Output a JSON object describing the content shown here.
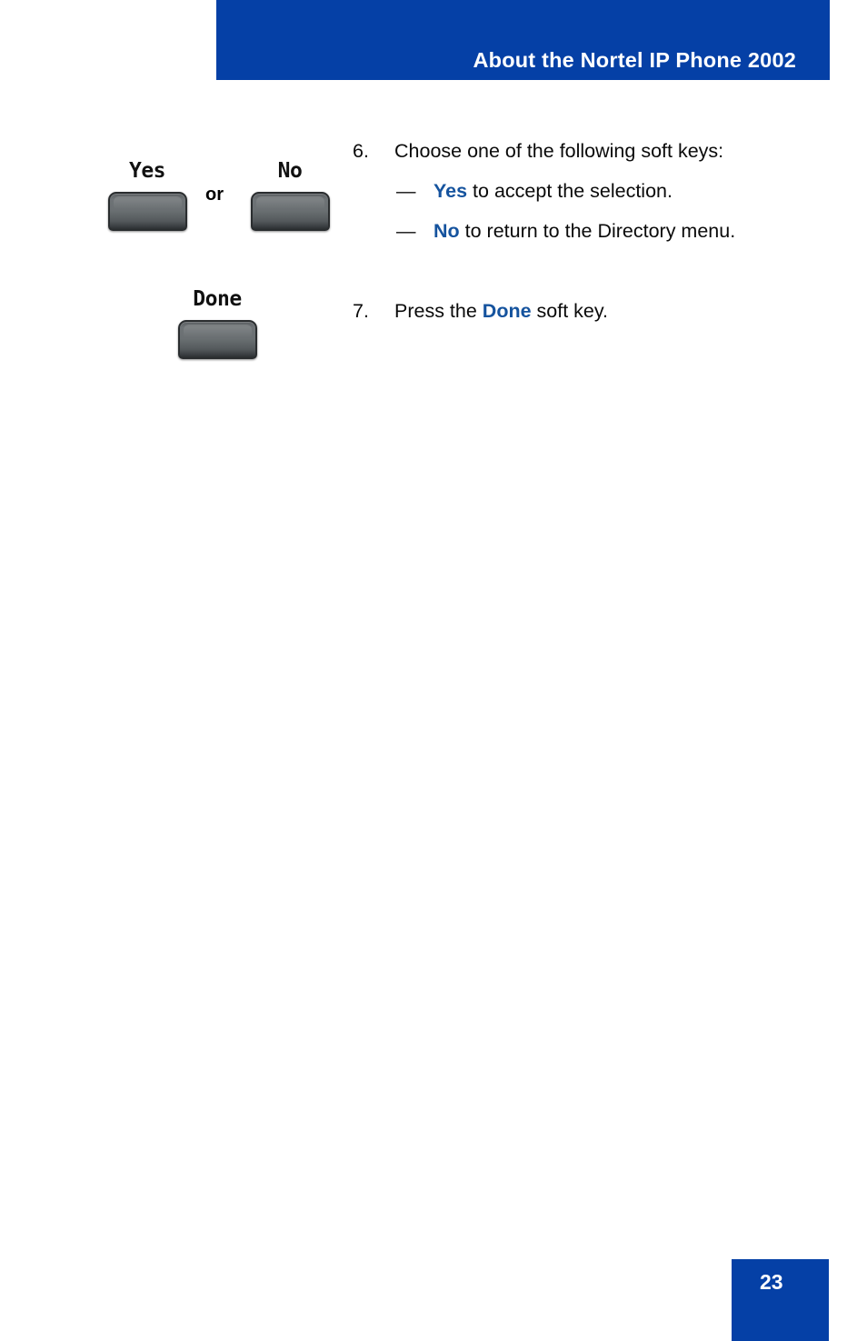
{
  "document": {
    "header": {
      "title": "About the Nortel IP Phone 2002",
      "band_color": "#0540a6"
    },
    "page_number": "23",
    "accent_color": "#15539e"
  },
  "figures": {
    "softkeys_yes_no": {
      "conjunction": "or",
      "keys": [
        {
          "label": "Yes",
          "icon": "softkey-button"
        },
        {
          "label": "No",
          "icon": "softkey-button"
        }
      ]
    },
    "softkey_done": {
      "keys": [
        {
          "label": "Done",
          "icon": "softkey-button"
        }
      ]
    }
  },
  "steps": [
    {
      "number": "6.",
      "text": "Choose one of the following soft keys:",
      "subitems": [
        {
          "dash": "—",
          "key": "Yes",
          "rest": " to accept the selection."
        },
        {
          "dash": "—",
          "key": "No",
          "rest": " to return to the Directory menu."
        }
      ]
    },
    {
      "number": "7.",
      "prefix": "Press the ",
      "key": "Done",
      "suffix": " soft key."
    }
  ]
}
